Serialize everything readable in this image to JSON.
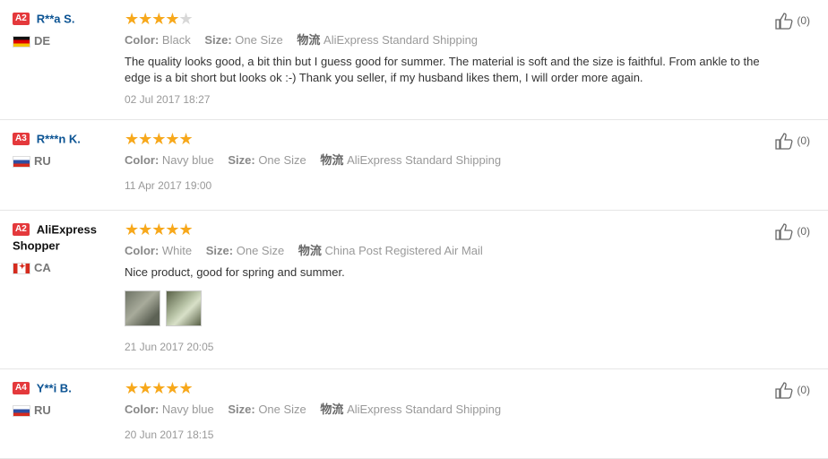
{
  "reviews": [
    {
      "badge": "A2",
      "name": "R**a S.",
      "country": "DE",
      "rating": 4,
      "color_label": "Color:",
      "color_value": "Black",
      "size_label": "Size:",
      "size_value": "One Size",
      "ship_label": "物流",
      "ship_value": "AliExpress Standard Shipping",
      "text": "The quality looks good, a bit thin but I guess good for summer. The material is soft and the size is faithful. From ankle to the edge is a bit short but looks ok :-) Thank you seller, if my husband likes them, I will order more again.",
      "date": "02 Jul 2017 18:27",
      "helpful_count": "(0)"
    },
    {
      "badge": "A3",
      "name": "R***n K.",
      "country": "RU",
      "rating": 5,
      "color_label": "Color:",
      "color_value": "Navy blue",
      "size_label": "Size:",
      "size_value": "One Size",
      "ship_label": "物流",
      "ship_value": "AliExpress Standard Shipping",
      "date": "11 Apr 2017 19:00",
      "helpful_count": "(0)"
    },
    {
      "badge": "A2",
      "name": "AliExpress Shopper",
      "country": "CA",
      "rating": 5,
      "color_label": "Color:",
      "color_value": "White",
      "size_label": "Size:",
      "size_value": "One Size",
      "ship_label": "物流",
      "ship_value": "China Post Registered Air Mail",
      "text": "Nice product, good for spring and summer.",
      "date": "21 Jun 2017 20:05",
      "helpful_count": "(0)"
    },
    {
      "badge": "A4",
      "name": "Y**i B.",
      "country": "RU",
      "rating": 5,
      "color_label": "Color:",
      "color_value": "Navy blue",
      "size_label": "Size:",
      "size_value": "One Size",
      "ship_label": "物流",
      "ship_value": "AliExpress Standard Shipping",
      "date": "20 Jun 2017 18:15",
      "helpful_count": "(0)"
    }
  ],
  "colors": {
    "star": "#f7a81b",
    "badge": "#e4393c",
    "name": "#0b5393"
  },
  "icons": {
    "helpful": "thumbs-up-icon",
    "rating": "star-icon"
  }
}
